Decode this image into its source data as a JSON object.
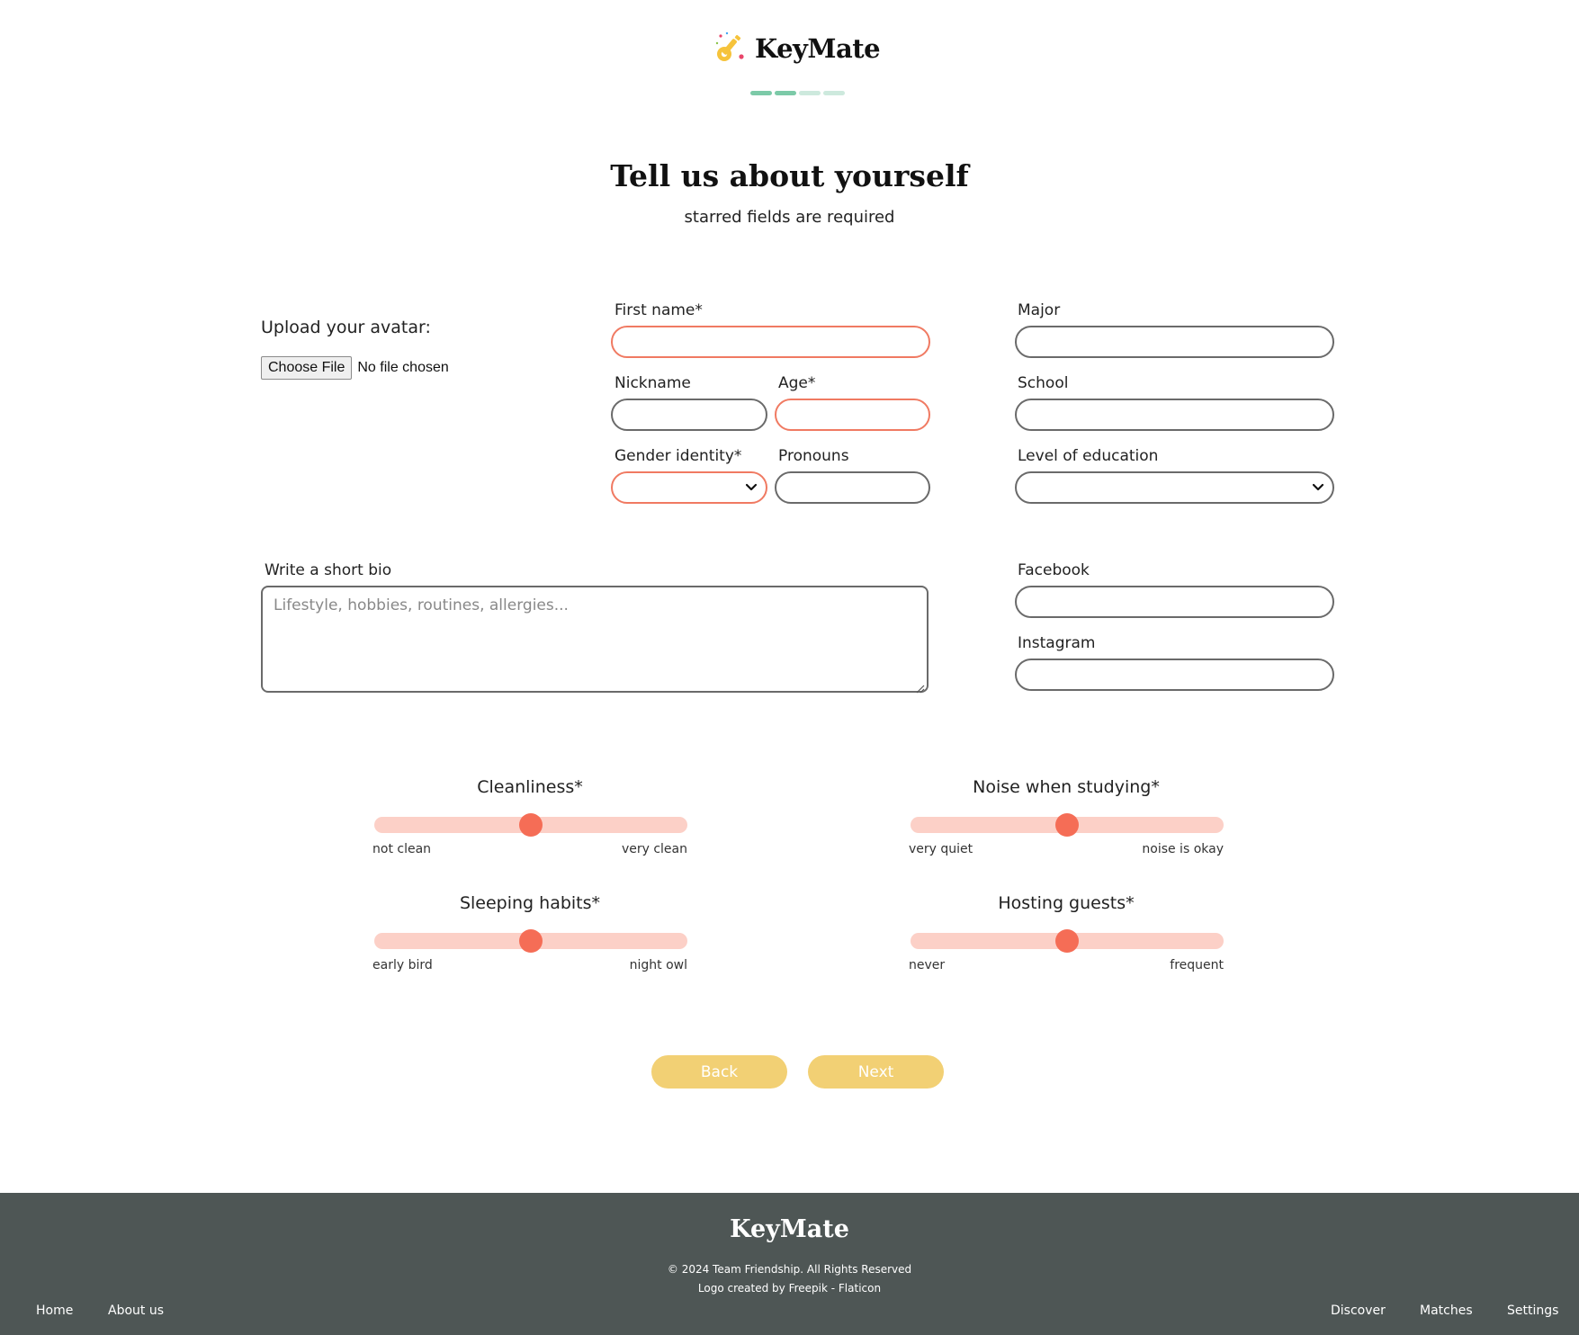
{
  "brand": {
    "name": "KeyMate",
    "accent": "#f56d56",
    "button_color": "#f2d074"
  },
  "progress_steps": [
    {
      "color": "#7ccaa8",
      "state": "complete"
    },
    {
      "color": "#7ccaa8",
      "state": "complete"
    },
    {
      "color": "#cde9dd",
      "state": "pending"
    },
    {
      "color": "#cde9dd",
      "state": "pending"
    }
  ],
  "page": {
    "title": "Tell us about yourself",
    "subtitle": "starred fields are required"
  },
  "avatar": {
    "label": "Upload your avatar:",
    "button": "Choose File",
    "status": "No file chosen"
  },
  "fields": {
    "first_name": {
      "label": "First name*",
      "value": ""
    },
    "nickname": {
      "label": "Nickname",
      "value": ""
    },
    "age": {
      "label": "Age*",
      "value": ""
    },
    "gender_identity": {
      "label": "Gender identity*",
      "value": ""
    },
    "pronouns": {
      "label": "Pronouns",
      "value": ""
    },
    "major": {
      "label": "Major",
      "value": ""
    },
    "school": {
      "label": "School",
      "value": ""
    },
    "level_of_education": {
      "label": "Level of education",
      "value": ""
    },
    "bio": {
      "label": "Write a short bio",
      "placeholder": "Lifestyle, hobbies, routines, allergies..."
    },
    "facebook": {
      "label": "Facebook",
      "value": ""
    },
    "instagram": {
      "label": "Instagram",
      "value": ""
    }
  },
  "sliders": {
    "cleanliness": {
      "title": "Cleanliness*",
      "min_label": "not clean",
      "max_label": "very clean",
      "value": 0.5
    },
    "noise": {
      "title": "Noise when studying*",
      "min_label": "very quiet",
      "max_label": "noise is okay",
      "value": 0.5
    },
    "sleeping": {
      "title": "Sleeping habits*",
      "min_label": "early bird",
      "max_label": "night owl",
      "value": 0.5
    },
    "hosting": {
      "title": "Hosting guests*",
      "min_label": "never",
      "max_label": "frequent",
      "value": 0.5
    }
  },
  "buttons": {
    "back": "Back",
    "next": "Next"
  },
  "footer": {
    "brand": "KeyMate",
    "copyright": "© 2024 Team Friendship. All Rights Reserved",
    "credit": "Logo created by Freepik - Flaticon",
    "links_left": [
      "Home",
      "About us"
    ],
    "links_right": [
      "Discover",
      "Matches",
      "Settings"
    ]
  }
}
